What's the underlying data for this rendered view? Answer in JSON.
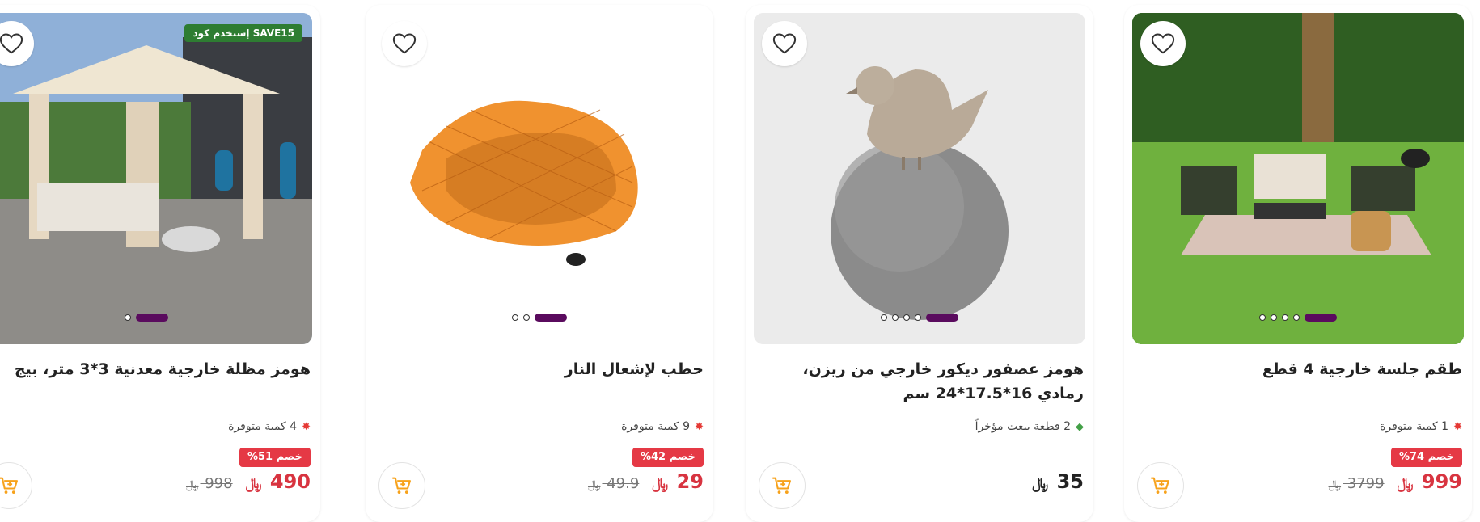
{
  "products": [
    {
      "title": "هومز مظلة خارجية معدنية 3*3 متر، بيج",
      "promo": "إستخدم كود SAVE15",
      "stock_text": "4 كمية متوفرة",
      "discount": "خصم 51%",
      "price": "490",
      "old_price": "998",
      "currency": "﷼",
      "dots": 2
    },
    {
      "title": "حطب لإشعال النار",
      "stock_text": "9 كمية متوفرة",
      "discount": "خصم 42%",
      "price": "29",
      "old_price": "49.9",
      "currency": "﷼",
      "dots": 3
    },
    {
      "title": "هومز عصفور ديكور خارجي من ريزن، رمادي 16*17.5*24 سم",
      "stock_text": "2 قطعة بيعت مؤخراً",
      "price": "35",
      "currency": "﷼",
      "dots": 5
    },
    {
      "title": "طقم جلسة خارجية 4 قطع",
      "stock_text": "1 كمية متوفرة",
      "discount": "خصم 74%",
      "price": "999",
      "old_price": "3799",
      "currency": "﷼",
      "dots": 5
    }
  ],
  "colors": {
    "price_red": "#d83440",
    "discount_bg": "#e53945",
    "promo_bg": "#2e7d32",
    "dot_active": "#5a0b5e",
    "cart_icon": "#f7a21b"
  },
  "icons": {
    "favorite": "heart-outline-icon",
    "cart": "add-to-cart-icon",
    "stock_low": "fire-icon",
    "recently_sold": "tag-icon"
  }
}
